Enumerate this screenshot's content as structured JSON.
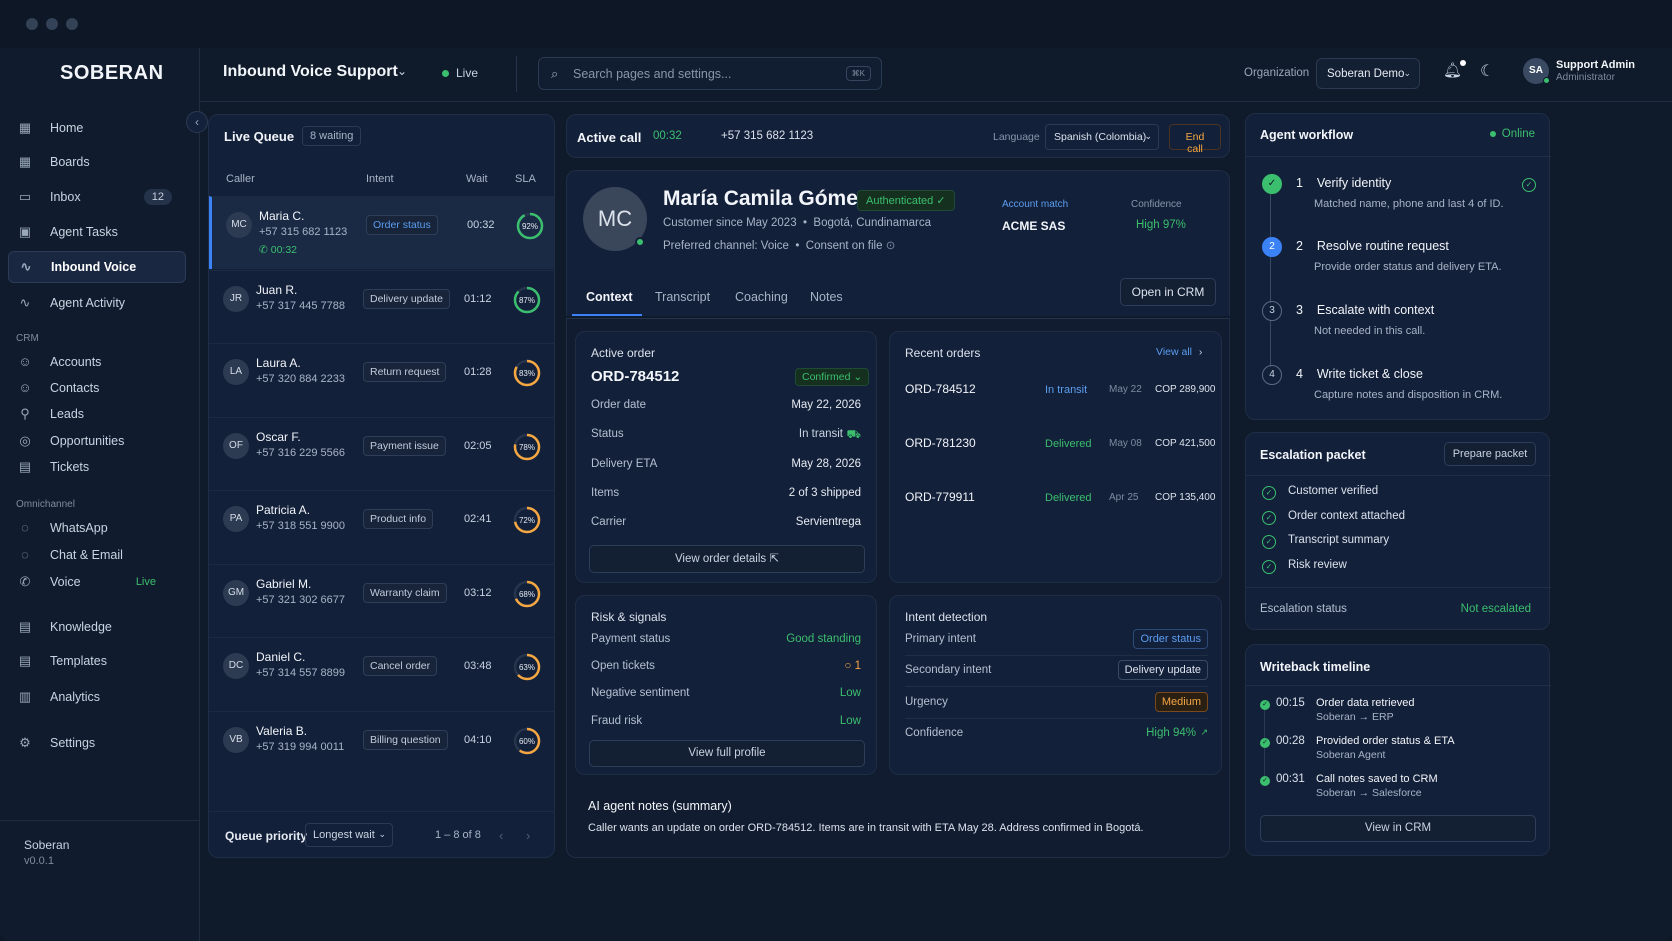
{
  "app": {
    "logo": "SOBERAN",
    "footer_name": "Soberan",
    "footer_version": "v0.0.1"
  },
  "sidebar": {
    "items": [
      {
        "label": "Home",
        "icon": "home-icon"
      },
      {
        "label": "Boards",
        "icon": "boards-icon"
      },
      {
        "label": "Inbox",
        "icon": "inbox-icon",
        "badge": "12"
      },
      {
        "label": "Agent Tasks",
        "icon": "tasks-icon"
      },
      {
        "label": "Inbound Voice",
        "icon": "waveform-icon",
        "active": true
      },
      {
        "label": "Agent Activity",
        "icon": "activity-icon"
      }
    ],
    "crm_label": "CRM",
    "crm_items": [
      {
        "label": "Accounts",
        "icon": "accounts-icon"
      },
      {
        "label": "Contacts",
        "icon": "contacts-icon"
      },
      {
        "label": "Leads",
        "icon": "leads-icon"
      },
      {
        "label": "Opportunities",
        "icon": "opportunities-icon"
      },
      {
        "label": "Tickets",
        "icon": "tickets-icon"
      }
    ],
    "omni_label": "Omnichannel",
    "omni_items": [
      {
        "label": "WhatsApp",
        "icon": "whatsapp-icon"
      },
      {
        "label": "Chat & Email",
        "icon": "chat-icon"
      },
      {
        "label": "Voice",
        "icon": "phone-icon",
        "tag": "Live"
      }
    ],
    "bottom_items": [
      {
        "label": "Knowledge",
        "icon": "knowledge-icon"
      },
      {
        "label": "Templates",
        "icon": "templates-icon"
      },
      {
        "label": "Analytics",
        "icon": "analytics-icon"
      },
      {
        "label": "Settings",
        "icon": "settings-icon"
      }
    ]
  },
  "header": {
    "title": "Inbound Voice Support",
    "status": "Live",
    "search_placeholder": "Search pages and settings...",
    "search_shortcut": "⌘K",
    "org_label": "Organization",
    "org_value": "Soberan Demo",
    "user_initials": "SA",
    "user_name": "Support Admin",
    "user_role": "Administrator"
  },
  "queue": {
    "title": "Live Queue",
    "badge": "8 waiting",
    "columns": [
      "Caller",
      "Intent",
      "Wait",
      "SLA"
    ],
    "rows": [
      {
        "initials": "MC",
        "name": "Maria C.",
        "phone": "+57 315 682 1123",
        "intent": "Order status",
        "wait": "00:32",
        "sla": "92%",
        "sla_value": 0.92,
        "timer": "00:32",
        "selected": true
      },
      {
        "initials": "JR",
        "name": "Juan R.",
        "phone": "+57 317 445 7788",
        "intent": "Delivery update",
        "wait": "01:12",
        "sla": "87%",
        "sla_value": 0.87
      },
      {
        "initials": "LA",
        "name": "Laura A.",
        "phone": "+57 320 884 2233",
        "intent": "Return request",
        "wait": "01:28",
        "sla": "83%",
        "sla_value": 0.83
      },
      {
        "initials": "OF",
        "name": "Oscar F.",
        "phone": "+57 316 229 5566",
        "intent": "Payment issue",
        "wait": "02:05",
        "sla": "78%",
        "sla_value": 0.78
      },
      {
        "initials": "PA",
        "name": "Patricia A.",
        "phone": "+57 318 551 9900",
        "intent": "Product info",
        "wait": "02:41",
        "sla": "72%",
        "sla_value": 0.72
      },
      {
        "initials": "GM",
        "name": "Gabriel M.",
        "phone": "+57 321 302 6677",
        "intent": "Warranty claim",
        "wait": "03:12",
        "sla": "68%",
        "sla_value": 0.68
      },
      {
        "initials": "DC",
        "name": "Daniel C.",
        "phone": "+57 314 557 8899",
        "intent": "Cancel order",
        "wait": "03:48",
        "sla": "63%",
        "sla_value": 0.63
      },
      {
        "initials": "VB",
        "name": "Valeria B.",
        "phone": "+57 319 994 0011",
        "intent": "Billing question",
        "wait": "04:10",
        "sla": "60%",
        "sla_value": 0.6
      }
    ],
    "priority_label": "Queue priority",
    "priority_value": "Longest wait",
    "pagination": "1 – 8 of 8"
  },
  "call": {
    "label": "Active call",
    "timer": "00:32",
    "phone": "+57 315 682 1123",
    "language_label": "Language",
    "language_value": "Spanish (Colombia)",
    "end_label": "End call"
  },
  "profile": {
    "initials": "MC",
    "name": "María Camila Gómez",
    "auth": "Authenticated",
    "since": "Customer since May 2023",
    "location": "Bogotá, Cundinamarca",
    "channel": "Preferred channel: Voice",
    "consent": "Consent on file",
    "account_label": "Account match",
    "account_value": "ACME SAS",
    "confidence_label": "Confidence",
    "confidence_value": "High 97%"
  },
  "tabs": [
    "Context",
    "Transcript",
    "Coaching",
    "Notes"
  ],
  "open_crm": "Open in CRM",
  "order": {
    "title": "Active order",
    "id": "ORD-784512",
    "status_badge": "Confirmed",
    "rows": [
      {
        "k": "Order date",
        "v": "May 22, 2026"
      },
      {
        "k": "Status",
        "v": "In transit"
      },
      {
        "k": "Delivery ETA",
        "v": "May 28, 2026"
      },
      {
        "k": "Items",
        "v": "2 of 3 shipped"
      },
      {
        "k": "Carrier",
        "v": "Servientrega"
      }
    ],
    "button": "View order details"
  },
  "recent": {
    "title": "Recent orders",
    "view_all": "View all",
    "rows": [
      {
        "id": "ORD-784512",
        "status": "In transit",
        "date": "May 22",
        "amount": "COP 289,900"
      },
      {
        "id": "ORD-781230",
        "status": "Delivered",
        "date": "May 08",
        "amount": "COP 421,500"
      },
      {
        "id": "ORD-779911",
        "status": "Delivered",
        "date": "Apr 25",
        "amount": "COP 135,400"
      }
    ]
  },
  "risk": {
    "title": "Risk & signals",
    "rows": [
      {
        "k": "Payment status",
        "v": "Good standing"
      },
      {
        "k": "Open tickets",
        "v": "1"
      },
      {
        "k": "Negative sentiment",
        "v": "Low"
      },
      {
        "k": "Fraud risk",
        "v": "Low"
      }
    ],
    "button": "View full profile"
  },
  "intent": {
    "title": "Intent detection",
    "rows": [
      {
        "k": "Primary intent",
        "v": "Order status"
      },
      {
        "k": "Secondary intent",
        "v": "Delivery update"
      },
      {
        "k": "Urgency",
        "v": "Medium"
      },
      {
        "k": "Confidence",
        "v": "High 94%"
      }
    ]
  },
  "notes": {
    "title": "AI agent notes (summary)",
    "text": "Caller wants an update on order ORD-784512. Items are in transit with ETA May 28. Address confirmed in Bogotá."
  },
  "workflow": {
    "title": "Agent workflow",
    "status": "Online",
    "steps": [
      {
        "n": "1",
        "title": "Verify identity",
        "desc": "Matched name, phone and last 4 of ID."
      },
      {
        "n": "2",
        "title": "Resolve routine request",
        "desc": "Provide order status and delivery ETA."
      },
      {
        "n": "3",
        "title": "Escalate with context",
        "desc": "Not needed in this call."
      },
      {
        "n": "4",
        "title": "Write ticket & close",
        "desc": "Capture notes and disposition in CRM."
      }
    ]
  },
  "escalation": {
    "title": "Escalation packet",
    "button": "Prepare packet",
    "items": [
      "Customer verified",
      "Order context attached",
      "Transcript summary",
      "Risk review"
    ],
    "status_label": "Escalation status",
    "status_value": "Not escalated"
  },
  "timeline": {
    "title": "Writeback timeline",
    "items": [
      {
        "time": "00:15",
        "title": "Order data retrieved",
        "sub": "Soberan → ERP"
      },
      {
        "time": "00:28",
        "title": "Provided order status & ETA",
        "sub": "Soberan Agent"
      },
      {
        "time": "00:31",
        "title": "Call notes saved to CRM",
        "sub": "Soberan → Salesforce"
      }
    ],
    "button": "View in CRM"
  },
  "colors": {
    "accent": "#3b82f6",
    "success": "#3bbf6e",
    "warning": "#f5a742",
    "bg": "#0f1a2a"
  }
}
